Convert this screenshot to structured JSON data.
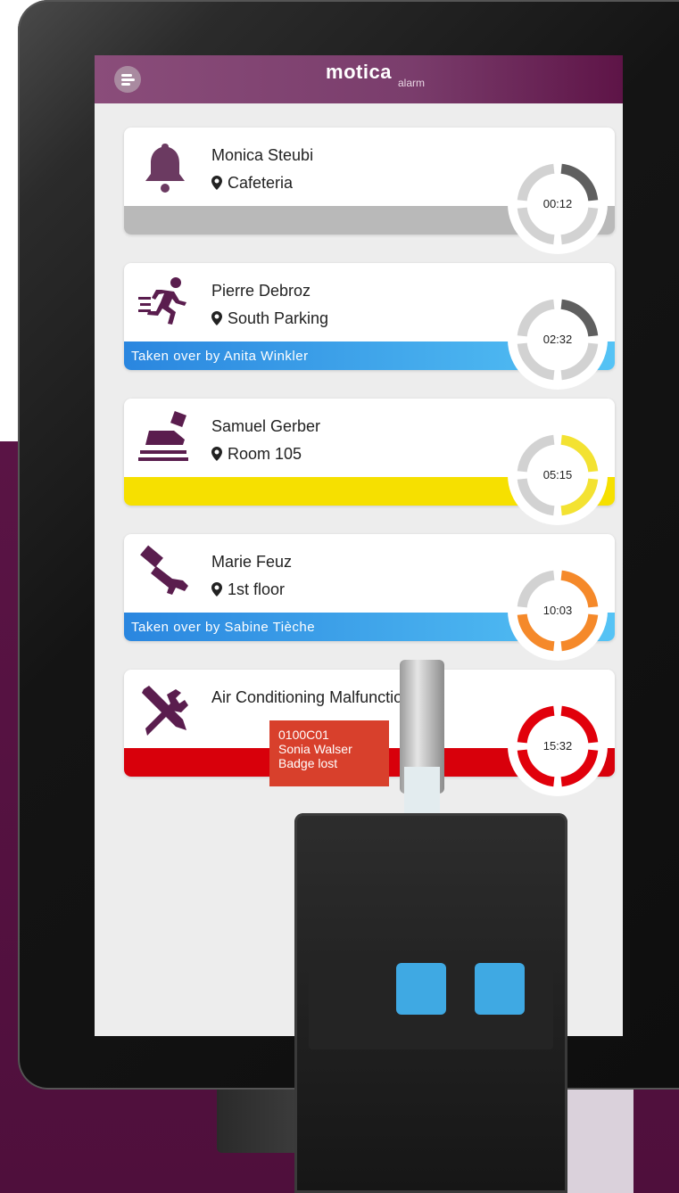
{
  "app": {
    "name": "motica",
    "subtitle": "alarm"
  },
  "alarms": [
    {
      "name": "Monica Steubi",
      "location": "Cafeteria",
      "timer": "00:12",
      "band_text": "",
      "band_color": "#b9b9b9",
      "icon": "bell-icon",
      "progress_quarters": 1,
      "ring_color": "#5f5f5f"
    },
    {
      "name": "Pierre Debroz",
      "location": "South Parking",
      "timer": "02:32",
      "band_text": "Taken over by Anita Winkler",
      "band_color": "#2e8fe0",
      "icon": "running-person-icon",
      "progress_quarters": 1,
      "ring_color": "#5f5f5f"
    },
    {
      "name": "Samuel Gerber",
      "location": "Room 105",
      "timer": "05:15",
      "band_text": "",
      "band_color": "#f6e000",
      "icon": "foot-slip-icon",
      "progress_quarters": 2,
      "ring_color": "#f3e232"
    },
    {
      "name": "Marie Feuz",
      "location": "1st floor",
      "timer": "10:03",
      "band_text": "Taken over by Sabine Tièche",
      "band_color": "#2e8fe0",
      "icon": "fallen-hand-icon",
      "progress_quarters": 3,
      "ring_color": "#f5892a"
    },
    {
      "name": "Air Conditioning Malfunction",
      "location": "",
      "timer": "15:32",
      "band_text": "",
      "band_color": "#d8000b",
      "icon": "tools-icon",
      "progress_quarters": 4,
      "ring_color": "#e1000b"
    }
  ],
  "badge_alert": {
    "id": "0100C01",
    "person": "Sonia Walser",
    "status": "Badge lost"
  }
}
